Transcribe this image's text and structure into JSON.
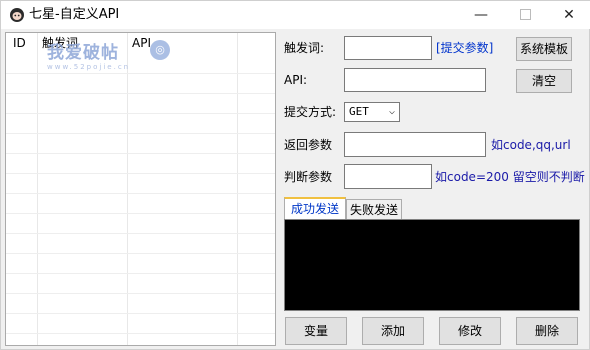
{
  "window": {
    "title": "七星-自定义API",
    "minimize": "—",
    "close": "✕"
  },
  "list": {
    "columns": [
      "ID",
      "触发词",
      "API"
    ]
  },
  "watermark": {
    "text": "我爱破帖",
    "sub": "www.52pojie.cn",
    "logo": "◎"
  },
  "form": {
    "trigger_label": "触发词:",
    "trigger_value": "",
    "submit_param_link": "[提交参数]",
    "system_template_button": "系统模板",
    "api_label": "API:",
    "api_value": "",
    "clear_button": "清空",
    "method_label": "提交方式:",
    "method_value": "GET",
    "return_label": "返回参数",
    "return_value": "",
    "return_hint": "如code,qq,url",
    "judge_label": "判断参数",
    "judge_value": "",
    "judge_hint": "如code=200  留空则不判断"
  },
  "tabs": {
    "success": "成功发送",
    "failure": "失败发送"
  },
  "buttons": {
    "variable": "变量",
    "add": "添加",
    "modify": "修改",
    "delete": "删除"
  }
}
